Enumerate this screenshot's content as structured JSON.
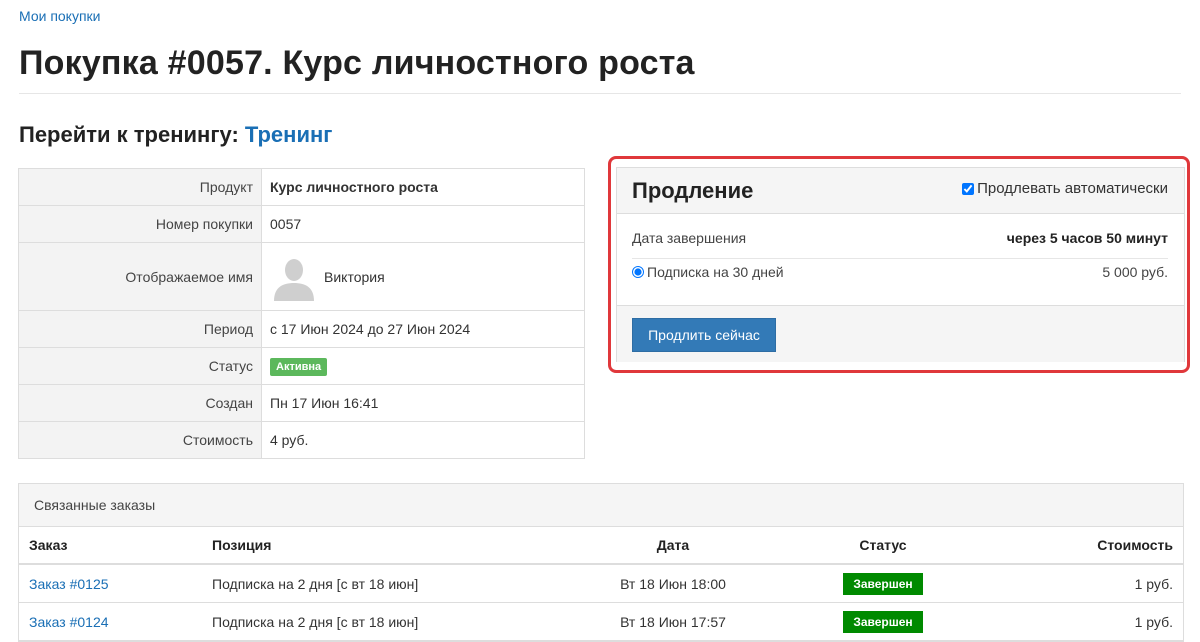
{
  "breadcrumb": "Мои покупки",
  "title": "Покупка #0057. Курс личностного роста",
  "goto": {
    "label": "Перейти к тренингу:",
    "link": "Тренинг"
  },
  "details": {
    "product_label": "Продукт",
    "product_value": "Курс личностного роста",
    "number_label": "Номер покупки",
    "number_value": "0057",
    "name_label": "Отображаемое имя",
    "name_value": "Виктория",
    "period_label": "Период",
    "period_value": "с 17 Июн 2024 до 27 Июн 2024",
    "status_label": "Статус",
    "status_value": "Активна",
    "created_label": "Создан",
    "created_value": "Пн 17 Июн 16:41",
    "cost_label": "Стоимость",
    "cost_value": "4 руб."
  },
  "renewal": {
    "title": "Продление",
    "auto_label": "Продлевать автоматически",
    "auto_checked": true,
    "end_label": "Дата завершения",
    "end_value": "через 5 часов 50 минут",
    "plan_label": "Подписка на 30 дней",
    "plan_price": "5 000 руб.",
    "button": "Продлить сейчас"
  },
  "orders": {
    "heading": "Связанные заказы",
    "columns": [
      "Заказ",
      "Позиция",
      "Дата",
      "Статус",
      "Стоимость"
    ],
    "rows": [
      {
        "order": "Заказ #0125",
        "position": "Подписка на 2 дня [с вт 18 июн]",
        "date": "Вт 18 Июн 18:00",
        "status": "Завершен",
        "cost": "1 руб."
      },
      {
        "order": "Заказ #0124",
        "position": "Подписка на 2 дня [с вт 18 июн]",
        "date": "Вт 18 Июн 17:57",
        "status": "Завершен",
        "cost": "1 руб."
      }
    ]
  },
  "colors": {
    "link": "#1a6fb5",
    "primary_button": "#337ab7",
    "active_badge": "#5cb85c",
    "done_badge": "#008a00",
    "highlight": "#e0383b"
  }
}
